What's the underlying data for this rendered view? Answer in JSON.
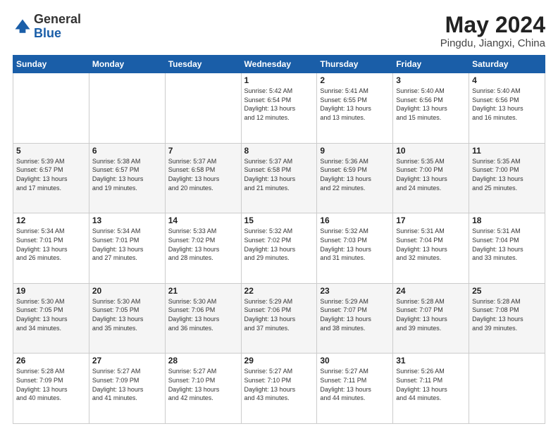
{
  "logo": {
    "general": "General",
    "blue": "Blue"
  },
  "title": "May 2024",
  "location": "Pingdu, Jiangxi, China",
  "weekdays": [
    "Sunday",
    "Monday",
    "Tuesday",
    "Wednesday",
    "Thursday",
    "Friday",
    "Saturday"
  ],
  "weeks": [
    [
      {
        "day": "",
        "info": ""
      },
      {
        "day": "",
        "info": ""
      },
      {
        "day": "",
        "info": ""
      },
      {
        "day": "1",
        "info": "Sunrise: 5:42 AM\nSunset: 6:54 PM\nDaylight: 13 hours\nand 12 minutes."
      },
      {
        "day": "2",
        "info": "Sunrise: 5:41 AM\nSunset: 6:55 PM\nDaylight: 13 hours\nand 13 minutes."
      },
      {
        "day": "3",
        "info": "Sunrise: 5:40 AM\nSunset: 6:56 PM\nDaylight: 13 hours\nand 15 minutes."
      },
      {
        "day": "4",
        "info": "Sunrise: 5:40 AM\nSunset: 6:56 PM\nDaylight: 13 hours\nand 16 minutes."
      }
    ],
    [
      {
        "day": "5",
        "info": "Sunrise: 5:39 AM\nSunset: 6:57 PM\nDaylight: 13 hours\nand 17 minutes."
      },
      {
        "day": "6",
        "info": "Sunrise: 5:38 AM\nSunset: 6:57 PM\nDaylight: 13 hours\nand 19 minutes."
      },
      {
        "day": "7",
        "info": "Sunrise: 5:37 AM\nSunset: 6:58 PM\nDaylight: 13 hours\nand 20 minutes."
      },
      {
        "day": "8",
        "info": "Sunrise: 5:37 AM\nSunset: 6:58 PM\nDaylight: 13 hours\nand 21 minutes."
      },
      {
        "day": "9",
        "info": "Sunrise: 5:36 AM\nSunset: 6:59 PM\nDaylight: 13 hours\nand 22 minutes."
      },
      {
        "day": "10",
        "info": "Sunrise: 5:35 AM\nSunset: 7:00 PM\nDaylight: 13 hours\nand 24 minutes."
      },
      {
        "day": "11",
        "info": "Sunrise: 5:35 AM\nSunset: 7:00 PM\nDaylight: 13 hours\nand 25 minutes."
      }
    ],
    [
      {
        "day": "12",
        "info": "Sunrise: 5:34 AM\nSunset: 7:01 PM\nDaylight: 13 hours\nand 26 minutes."
      },
      {
        "day": "13",
        "info": "Sunrise: 5:34 AM\nSunset: 7:01 PM\nDaylight: 13 hours\nand 27 minutes."
      },
      {
        "day": "14",
        "info": "Sunrise: 5:33 AM\nSunset: 7:02 PM\nDaylight: 13 hours\nand 28 minutes."
      },
      {
        "day": "15",
        "info": "Sunrise: 5:32 AM\nSunset: 7:02 PM\nDaylight: 13 hours\nand 29 minutes."
      },
      {
        "day": "16",
        "info": "Sunrise: 5:32 AM\nSunset: 7:03 PM\nDaylight: 13 hours\nand 31 minutes."
      },
      {
        "day": "17",
        "info": "Sunrise: 5:31 AM\nSunset: 7:04 PM\nDaylight: 13 hours\nand 32 minutes."
      },
      {
        "day": "18",
        "info": "Sunrise: 5:31 AM\nSunset: 7:04 PM\nDaylight: 13 hours\nand 33 minutes."
      }
    ],
    [
      {
        "day": "19",
        "info": "Sunrise: 5:30 AM\nSunset: 7:05 PM\nDaylight: 13 hours\nand 34 minutes."
      },
      {
        "day": "20",
        "info": "Sunrise: 5:30 AM\nSunset: 7:05 PM\nDaylight: 13 hours\nand 35 minutes."
      },
      {
        "day": "21",
        "info": "Sunrise: 5:30 AM\nSunset: 7:06 PM\nDaylight: 13 hours\nand 36 minutes."
      },
      {
        "day": "22",
        "info": "Sunrise: 5:29 AM\nSunset: 7:06 PM\nDaylight: 13 hours\nand 37 minutes."
      },
      {
        "day": "23",
        "info": "Sunrise: 5:29 AM\nSunset: 7:07 PM\nDaylight: 13 hours\nand 38 minutes."
      },
      {
        "day": "24",
        "info": "Sunrise: 5:28 AM\nSunset: 7:07 PM\nDaylight: 13 hours\nand 39 minutes."
      },
      {
        "day": "25",
        "info": "Sunrise: 5:28 AM\nSunset: 7:08 PM\nDaylight: 13 hours\nand 39 minutes."
      }
    ],
    [
      {
        "day": "26",
        "info": "Sunrise: 5:28 AM\nSunset: 7:09 PM\nDaylight: 13 hours\nand 40 minutes."
      },
      {
        "day": "27",
        "info": "Sunrise: 5:27 AM\nSunset: 7:09 PM\nDaylight: 13 hours\nand 41 minutes."
      },
      {
        "day": "28",
        "info": "Sunrise: 5:27 AM\nSunset: 7:10 PM\nDaylight: 13 hours\nand 42 minutes."
      },
      {
        "day": "29",
        "info": "Sunrise: 5:27 AM\nSunset: 7:10 PM\nDaylight: 13 hours\nand 43 minutes."
      },
      {
        "day": "30",
        "info": "Sunrise: 5:27 AM\nSunset: 7:11 PM\nDaylight: 13 hours\nand 44 minutes."
      },
      {
        "day": "31",
        "info": "Sunrise: 5:26 AM\nSunset: 7:11 PM\nDaylight: 13 hours\nand 44 minutes."
      },
      {
        "day": "",
        "info": ""
      }
    ]
  ]
}
